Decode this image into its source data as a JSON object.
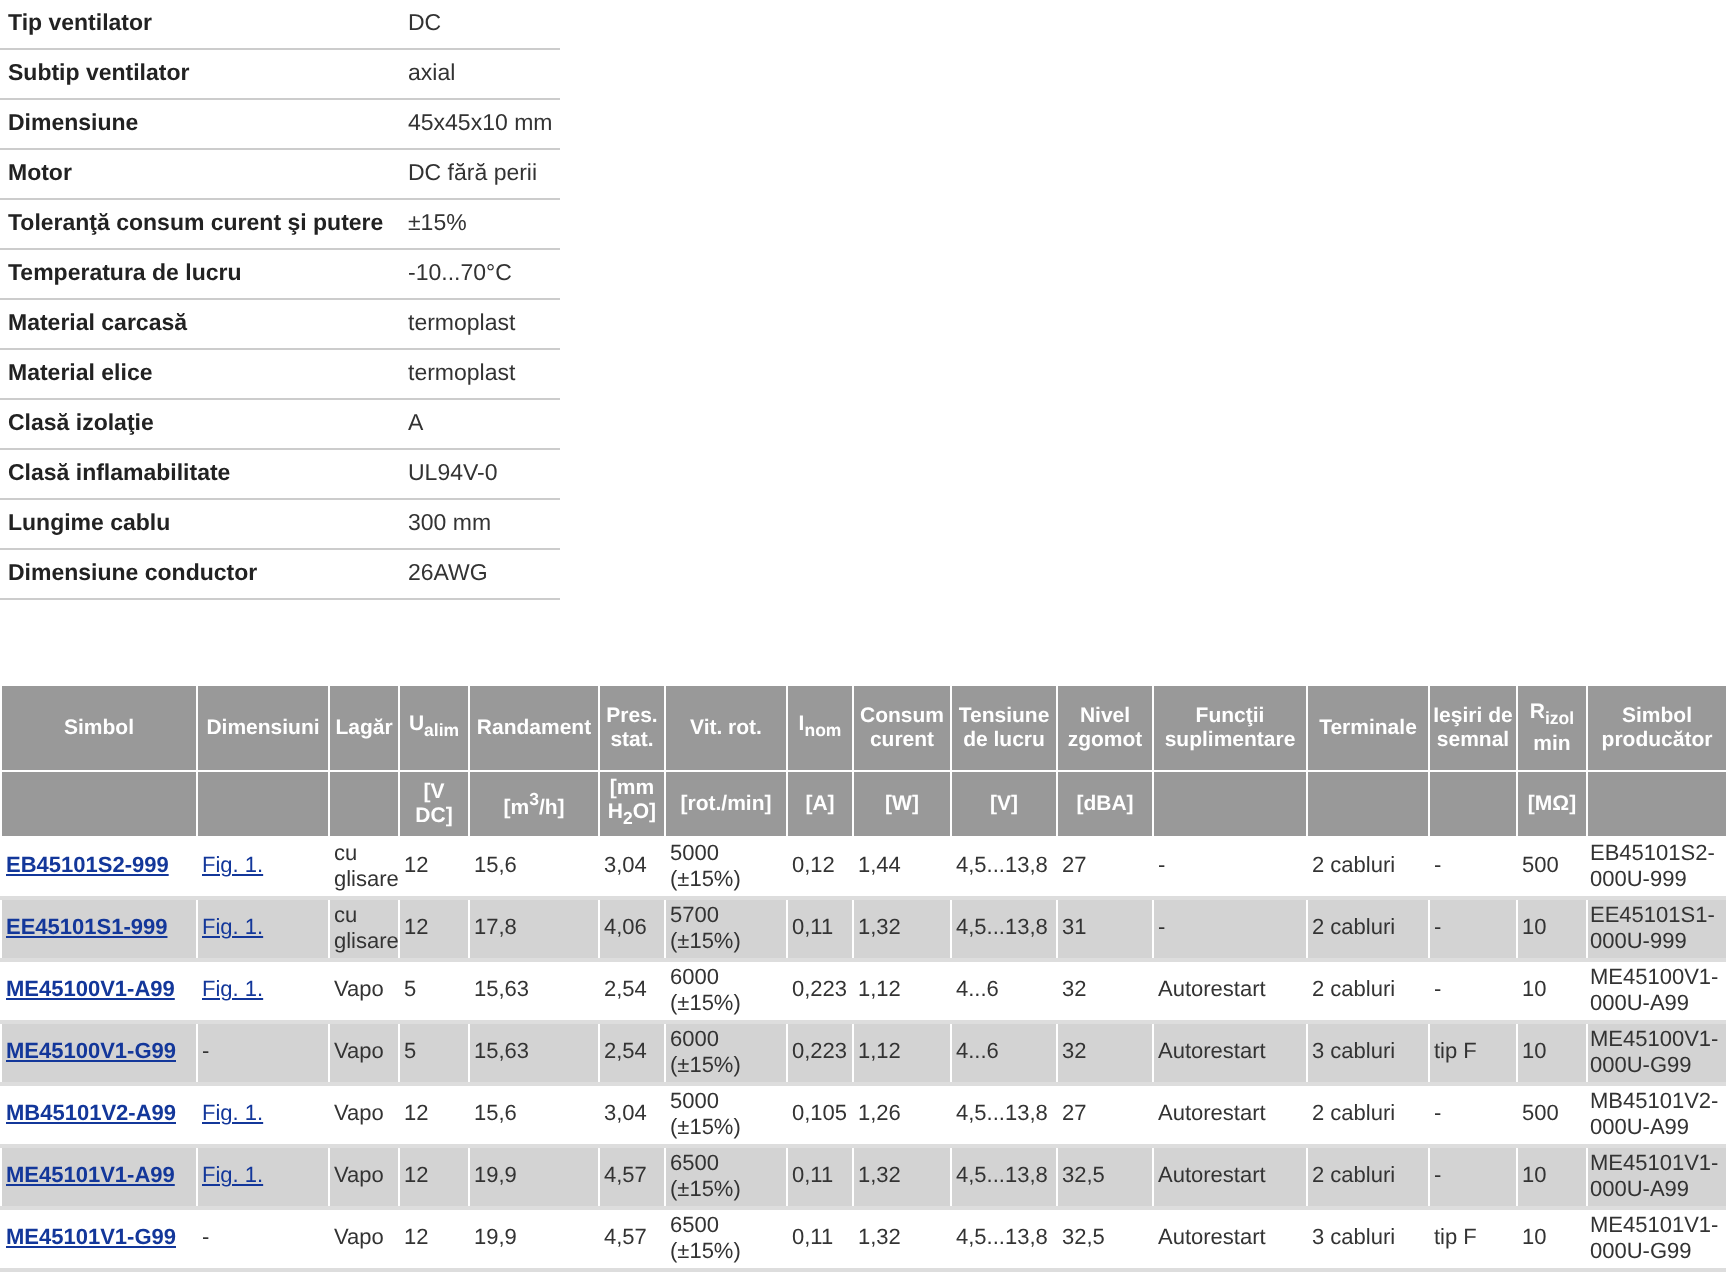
{
  "specs": [
    {
      "label": "Tip ventilator",
      "value": "DC"
    },
    {
      "label": "Subtip ventilator",
      "value": "axial"
    },
    {
      "label": "Dimensiune",
      "value": "45x45x10 mm"
    },
    {
      "label": "Motor",
      "value": "DC fără perii"
    },
    {
      "label": "Toleranţă consum curent şi putere",
      "value": "±15%"
    },
    {
      "label": "Temperatura de lucru",
      "value": "-10...70°C"
    },
    {
      "label": "Material carcasă",
      "value": "termoplast"
    },
    {
      "label": "Material elice",
      "value": "termoplast"
    },
    {
      "label": "Clasă izolaţie",
      "value": "A"
    },
    {
      "label": "Clasă inflamabilitate",
      "value": "UL94V-0"
    },
    {
      "label": "Lungime cablu",
      "value": "300 mm"
    },
    {
      "label": "Dimensiune conductor",
      "value": "26AWG"
    }
  ],
  "table": {
    "columns": [
      {
        "title": "Simbol"
      },
      {
        "title": "Dimensiuni"
      },
      {
        "title": "Lagăr"
      },
      {
        "title": "U$_{alim}$",
        "unit": "[V DC]"
      },
      {
        "title": "Randament",
        "unit": "[m$^{3}$/h]"
      },
      {
        "title": "Pres. stat.",
        "unit": "[mm H$_{2}$O]"
      },
      {
        "title": "Vit. rot.",
        "unit": "[rot./min]"
      },
      {
        "title": "I$_{nom}$",
        "unit": "[A]"
      },
      {
        "title": "Consum curent",
        "unit": "[W]"
      },
      {
        "title": "Tensiune de lucru",
        "unit": "[V]"
      },
      {
        "title": "Nivel zgomot",
        "unit": "[dBA]"
      },
      {
        "title": "Funcţii suplimentare"
      },
      {
        "title": "Terminale"
      },
      {
        "title": "Ieşiri de semnal"
      },
      {
        "title": "R$_{izol}$ min",
        "unit": "[MΩ]"
      },
      {
        "title": "Simbol producător"
      }
    ],
    "rows": [
      {
        "symbol": "EB45101S2-999",
        "figure": {
          "text": "Fig. 1.",
          "link": true
        },
        "values": [
          "cu glisare",
          "12",
          "15,6",
          "3,04",
          "5000 (±15%)",
          "0,12",
          "1,44",
          "4,5...13,8",
          "27",
          "-",
          "2 cabluri",
          "-",
          "500",
          "EB45101S2-000U-999"
        ]
      },
      {
        "symbol": "EE45101S1-999",
        "figure": {
          "text": "Fig. 1.",
          "link": true
        },
        "values": [
          "cu glisare",
          "12",
          "17,8",
          "4,06",
          "5700 (±15%)",
          "0,11",
          "1,32",
          "4,5...13,8",
          "31",
          "-",
          "2 cabluri",
          "-",
          "10",
          "EE45101S1-000U-999"
        ]
      },
      {
        "symbol": "ME45100V1-A99",
        "figure": {
          "text": "Fig. 1.",
          "link": true
        },
        "values": [
          "Vapo",
          "5",
          "15,63",
          "2,54",
          "6000 (±15%)",
          "0,223",
          "1,12",
          "4...6",
          "32",
          "Autorestart",
          "2 cabluri",
          "-",
          "10",
          "ME45100V1-000U-A99"
        ]
      },
      {
        "symbol": "ME45100V1-G99",
        "figure": {
          "text": "-",
          "link": false
        },
        "values": [
          "Vapo",
          "5",
          "15,63",
          "2,54",
          "6000 (±15%)",
          "0,223",
          "1,12",
          "4...6",
          "32",
          "Autorestart",
          "3 cabluri",
          "tip F",
          "10",
          "ME45100V1-000U-G99"
        ]
      },
      {
        "symbol": "MB45101V2-A99",
        "figure": {
          "text": "Fig. 1.",
          "link": true
        },
        "values": [
          "Vapo",
          "12",
          "15,6",
          "3,04",
          "5000 (±15%)",
          "0,105",
          "1,26",
          "4,5...13,8",
          "27",
          "Autorestart",
          "2 cabluri",
          "-",
          "500",
          "MB45101V2-000U-A99"
        ]
      },
      {
        "symbol": "ME45101V1-A99",
        "figure": {
          "text": "Fig. 1.",
          "link": true
        },
        "values": [
          "Vapo",
          "12",
          "19,9",
          "4,57",
          "6500 (±15%)",
          "0,11",
          "1,32",
          "4,5...13,8",
          "32,5",
          "Autorestart",
          "2 cabluri",
          "-",
          "10",
          "ME45101V1-000U-A99"
        ]
      },
      {
        "symbol": "ME45101V1-G99",
        "figure": {
          "text": "-",
          "link": false
        },
        "values": [
          "Vapo",
          "12",
          "19,9",
          "4,57",
          "6500 (±15%)",
          "0,11",
          "1,32",
          "4,5...13,8",
          "32,5",
          "Autorestart",
          "3 cabluri",
          "tip F",
          "10",
          "ME45101V1-000U-G99"
        ]
      }
    ]
  }
}
